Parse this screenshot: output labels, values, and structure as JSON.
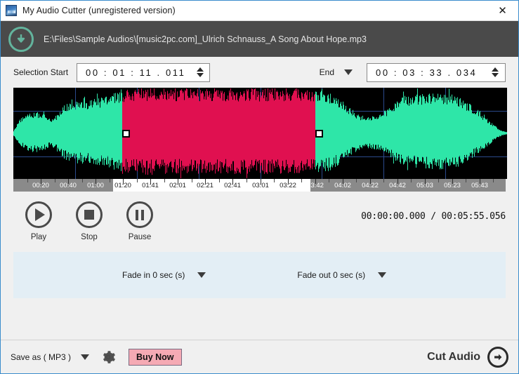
{
  "window": {
    "title": "My Audio Cutter (unregistered version)",
    "close_label": "✕",
    "app_icon": "app-logo-icon"
  },
  "header": {
    "download_icon": "download-arrow-icon",
    "file_path": "E:\\Files\\Sample Audios\\[music2pc.com]_Ulrich Schnauss_A Song About Hope.mp3"
  },
  "selection": {
    "start_label": "Selection Start",
    "start_value": "00 : 01 : 11 . 011",
    "end_label": "End",
    "end_value": "00 : 03 : 33 . 034",
    "end_dropdown_icon": "chevron-down-icon",
    "spinner_up_icon": "spinner-up-icon",
    "spinner_down_icon": "spinner-down-icon"
  },
  "waveform": {
    "total_duration": "00:05:55.056",
    "selection_start": "00:01:11.011",
    "selection_end": "00:03:33.034",
    "colors": {
      "background": "#000000",
      "grid": "#2b4a8c",
      "unselected": "#2ee6a8",
      "selected": "#e01050",
      "ruler": "#8a8a8a",
      "ruler_selected": "#ffffff"
    },
    "ruler_labels": [
      "00:20",
      "00:40",
      "01:00",
      "01:20",
      "01:41",
      "02:01",
      "02:21",
      "02:41",
      "03:01",
      "03:22",
      "03:42",
      "04:02",
      "04:22",
      "04:42",
      "05:03",
      "05:23",
      "05:43"
    ],
    "handle_left_name": "selection-start-handle",
    "handle_right_name": "selection-end-handle"
  },
  "transport": {
    "play_label": "Play",
    "stop_label": "Stop",
    "pause_label": "Pause",
    "timecode": "00:00:00.000 / 00:05:55.056"
  },
  "fade": {
    "fade_in_label": "Fade in 0 sec (s)",
    "fade_out_label": "Fade out 0 sec (s)",
    "dropdown_icon": "chevron-down-icon",
    "panel_color": "#e3eef5"
  },
  "bottom": {
    "save_as_label": "Save as ( MP3 )",
    "save_dropdown_icon": "chevron-down-icon",
    "settings_icon": "gear-icon",
    "buy_now_label": "Buy Now",
    "buy_now_color": "#f5aab4",
    "cut_audio_label": "Cut Audio",
    "cut_audio_icon": "arrow-right-circle-icon"
  }
}
